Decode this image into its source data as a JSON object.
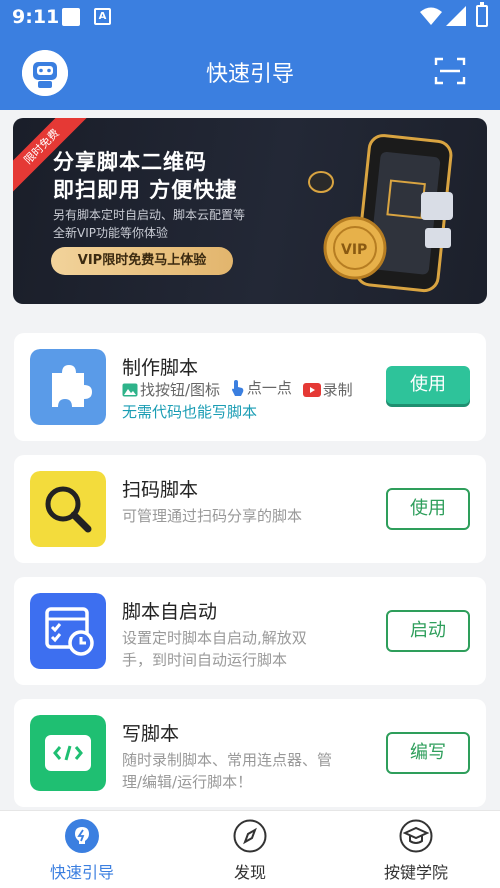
{
  "status_bar": {
    "time": "9:11"
  },
  "header": {
    "title": "快速引导"
  },
  "banner": {
    "ribbon": "限时免费",
    "headline_1": "分享脚本二维码",
    "headline_2": "即扫即用 方便快捷",
    "line_1": "另有脚本定时自启动、脚本云配置等",
    "line_2": "全新VIP功能等你体验",
    "cta": "VIP限时免费马上体验"
  },
  "cards": [
    {
      "title": "制作脚本",
      "features": [
        {
          "icon": "image-icon",
          "label": "找按钮/图标"
        },
        {
          "icon": "tap-hand-icon",
          "label": "点一点"
        },
        {
          "icon": "record-icon",
          "label": "录制"
        }
      ],
      "tip": "无需代码也能写脚本",
      "button": "使用",
      "icon": "puzzle-icon",
      "color": "#5a9be8"
    },
    {
      "title": "扫码脚本",
      "desc": "可管理通过扫码分享的脚本",
      "button": "使用",
      "icon": "magnifier-icon",
      "color": "#f3dc3c"
    },
    {
      "title": "脚本自启动",
      "desc_1": "设置定时脚本自启动,解放双",
      "desc_2": "手，到时间自动运行脚本",
      "button": "启动",
      "icon": "schedule-icon",
      "color": "#3d6ff0"
    },
    {
      "title": "写脚本",
      "desc_1": "随时录制脚本、常用连点器、管",
      "desc_2": "理/编辑/运行脚本！",
      "button": "编写",
      "icon": "code-window-icon",
      "color": "#1fbf72"
    }
  ],
  "bottom_nav": [
    {
      "label": "快速引导",
      "icon": "bulb-icon",
      "active": true
    },
    {
      "label": "发现",
      "icon": "compass-icon",
      "active": false
    },
    {
      "label": "按键学院",
      "icon": "graduation-cap-icon",
      "active": false
    }
  ],
  "colors": {
    "primary": "#3b7fe0",
    "green": "#2e9e5b",
    "teal_button": "#2ec39a",
    "tip_text": "#1a9db4"
  }
}
